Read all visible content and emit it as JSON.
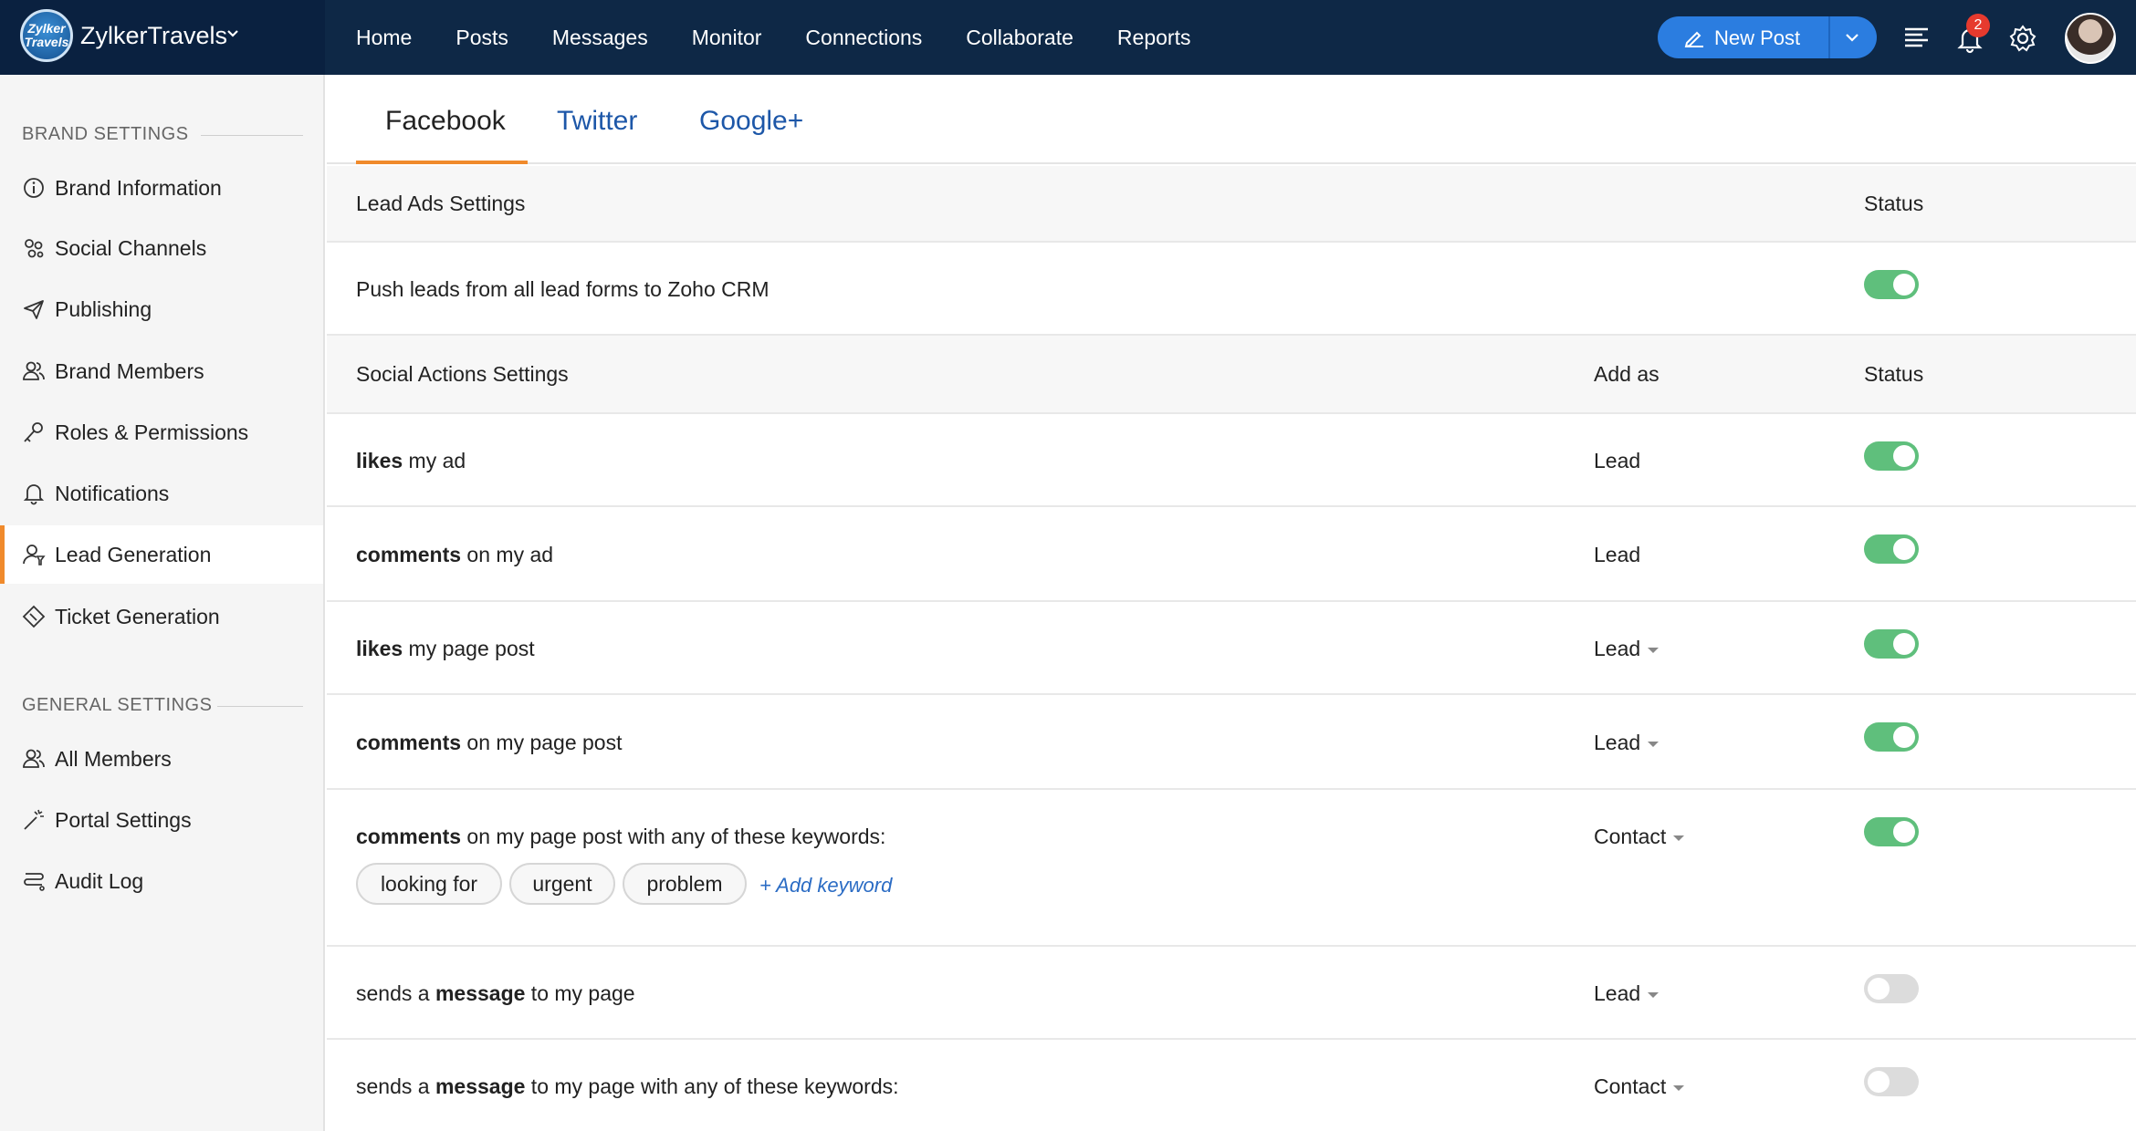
{
  "app": {
    "brand_name": "ZylkerTravels",
    "logo_text": "Zylker Travels"
  },
  "nav": {
    "items": [
      "Home",
      "Posts",
      "Messages",
      "Monitor",
      "Connections",
      "Collaborate",
      "Reports"
    ],
    "new_post_label": "New Post",
    "notification_count": "2"
  },
  "sidebar": {
    "brand_settings_title": "BRAND SETTINGS",
    "brand_items": [
      {
        "label": "Brand Information",
        "icon": "info-icon"
      },
      {
        "label": "Social Channels",
        "icon": "social-channels-icon"
      },
      {
        "label": "Publishing",
        "icon": "send-icon"
      },
      {
        "label": "Brand Members",
        "icon": "members-icon"
      },
      {
        "label": "Roles & Permissions",
        "icon": "key-icon"
      },
      {
        "label": "Notifications",
        "icon": "bell-icon"
      },
      {
        "label": "Lead Generation",
        "icon": "lead-icon"
      },
      {
        "label": "Ticket Generation",
        "icon": "ticket-icon"
      }
    ],
    "general_settings_title": "GENERAL SETTINGS",
    "general_items": [
      {
        "label": "All Members",
        "icon": "members-icon"
      },
      {
        "label": "Portal Settings",
        "icon": "magic-wand-icon"
      },
      {
        "label": "Audit Log",
        "icon": "audit-log-icon"
      }
    ],
    "active_item": "Lead Generation"
  },
  "tabs": [
    {
      "label": "Facebook",
      "active": true
    },
    {
      "label": "Twitter",
      "active": false
    },
    {
      "label": "Google+",
      "active": false
    }
  ],
  "lead_ads": {
    "header_title": "Lead Ads Settings",
    "header_status": "Status",
    "row_label": "Push leads from all lead forms to Zoho CRM",
    "row_enabled": true
  },
  "social_actions": {
    "header_title": "Social Actions Settings",
    "header_add_as": "Add as",
    "header_status": "Status",
    "rows": [
      {
        "bold": "likes",
        "rest": " my ad",
        "add_as": "Lead",
        "dropdown": false,
        "enabled": true
      },
      {
        "bold": "comments",
        "rest": " on my ad",
        "add_as": "Lead",
        "dropdown": false,
        "enabled": true
      },
      {
        "bold": "likes",
        "rest": " my page post",
        "add_as": "Lead",
        "dropdown": true,
        "enabled": true
      },
      {
        "bold": "comments",
        "rest": " on my page post",
        "add_as": "Lead",
        "dropdown": true,
        "enabled": true
      },
      {
        "bold": "comments",
        "rest": " on my page post with any of these keywords:",
        "add_as": "Contact",
        "dropdown": true,
        "enabled": true,
        "keywords": [
          "looking for",
          "urgent",
          "problem"
        ],
        "add_keyword_label": "+ Add keyword"
      },
      {
        "pre": "sends a ",
        "bold": "message",
        "rest": " to my page",
        "add_as": "Lead",
        "dropdown": true,
        "enabled": false
      },
      {
        "pre": "sends a ",
        "bold": "message",
        "rest": " to my page with any of these keywords:",
        "add_as": "Contact",
        "dropdown": true,
        "enabled": false
      }
    ]
  },
  "colors": {
    "topbar": "#0e2846",
    "accent": "#f08a2c",
    "toggle_on": "#5fbf7c",
    "link": "#1d57a8"
  }
}
